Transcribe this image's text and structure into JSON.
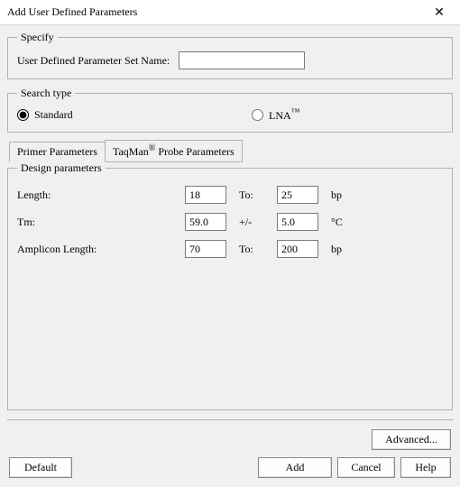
{
  "window": {
    "title": "Add User Defined Parameters"
  },
  "specify": {
    "legend": "Specify",
    "name_label": "User Defined Parameter Set Name:",
    "name_value": ""
  },
  "search_type": {
    "legend": "Search type",
    "standard_label": "Standard",
    "lna_label": "LNA",
    "lna_tm": "™",
    "selected": "standard"
  },
  "tabs": {
    "primer": "Primer Parameters",
    "taqman_prefix": "TaqMan",
    "taqman_reg": "®",
    "taqman_suffix": " Probe Parameters"
  },
  "design": {
    "legend": "Design parameters",
    "length_label": "Length:",
    "length_from": "18",
    "length_sep": "To:",
    "length_to": "25",
    "length_unit": "bp",
    "tm_label": "Tm:",
    "tm_value": "59.0",
    "tm_sep": "+/-",
    "tm_tol": "5.0",
    "tm_unit": "°C",
    "amp_label": "Amplicon Length:",
    "amp_from": "70",
    "amp_sep": "To:",
    "amp_to": "200",
    "amp_unit": "bp"
  },
  "buttons": {
    "advanced": "Advanced...",
    "default": "Default",
    "add": "Add",
    "cancel": "Cancel",
    "help": "Help"
  }
}
